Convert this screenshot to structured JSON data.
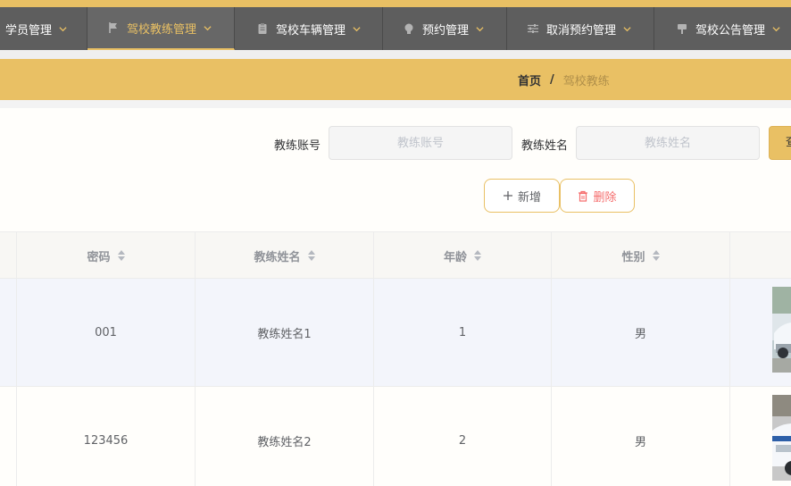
{
  "nav": {
    "items": [
      {
        "label": "学员管理",
        "icon": "none"
      },
      {
        "label": "驾校教练管理",
        "icon": "flag-icon",
        "active": true
      },
      {
        "label": "驾校车辆管理",
        "icon": "clipboard-icon"
      },
      {
        "label": "预约管理",
        "icon": "bulb-icon"
      },
      {
        "label": "取消预约管理",
        "icon": "sliders-icon"
      },
      {
        "label": "驾校公告管理",
        "icon": "sign-icon"
      }
    ]
  },
  "breadcrumb": {
    "home": "首页",
    "separator": "/",
    "current": "驾校教练"
  },
  "search": {
    "account_label": "教练账号",
    "account_placeholder": "教练账号",
    "name_label": "教练姓名",
    "name_placeholder": "教练姓名",
    "button_label": "查询"
  },
  "actions": {
    "add_label": "新增",
    "delete_label": "删除"
  },
  "table": {
    "columns": [
      "密码",
      "教练姓名",
      "年龄",
      "性别"
    ],
    "rows": [
      {
        "password": "001",
        "name": "教练姓名1",
        "age": "1",
        "gender": "男"
      },
      {
        "password": "123456",
        "name": "教练姓名2",
        "age": "2",
        "gender": "男"
      }
    ]
  },
  "colors": {
    "accent": "#e9c064",
    "nav_bg": "#5e5e5e",
    "delete_red": "#f56c6c"
  }
}
